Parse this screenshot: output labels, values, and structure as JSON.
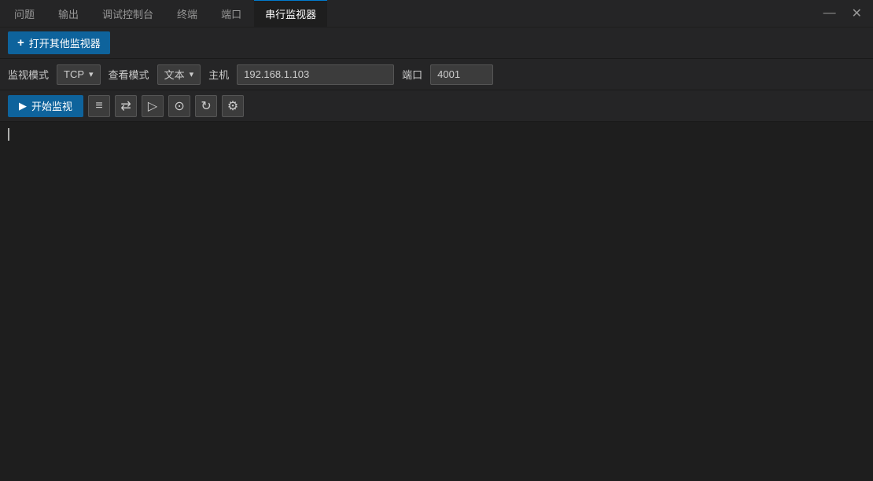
{
  "tabbar": {
    "items": [
      {
        "label": "问题",
        "active": false
      },
      {
        "label": "输出",
        "active": false
      },
      {
        "label": "调试控制台",
        "active": false
      },
      {
        "label": "终端",
        "active": false
      },
      {
        "label": "端口",
        "active": false
      },
      {
        "label": "串行监视器",
        "active": true
      }
    ],
    "minimize_label": "—",
    "close_label": "✕"
  },
  "toolbar1": {
    "open_button_label": "打开其他监视器",
    "plus_icon": "+"
  },
  "toolbar2": {
    "monitor_mode_label": "监视模式",
    "tcp_label": "TCP",
    "view_mode_label": "查看模式",
    "text_label": "文本",
    "host_label": "主机",
    "host_value": "192.168.1.103",
    "port_label": "端口",
    "port_value": "4001"
  },
  "toolbar3": {
    "start_button_label": "开始监视",
    "play_icon": "▶",
    "icon1": "≡",
    "icon2": "⇄",
    "icon3": "▷",
    "icon4": "⊙",
    "icon5": "↻",
    "icon6": "⚙"
  },
  "content": {
    "empty": ""
  }
}
